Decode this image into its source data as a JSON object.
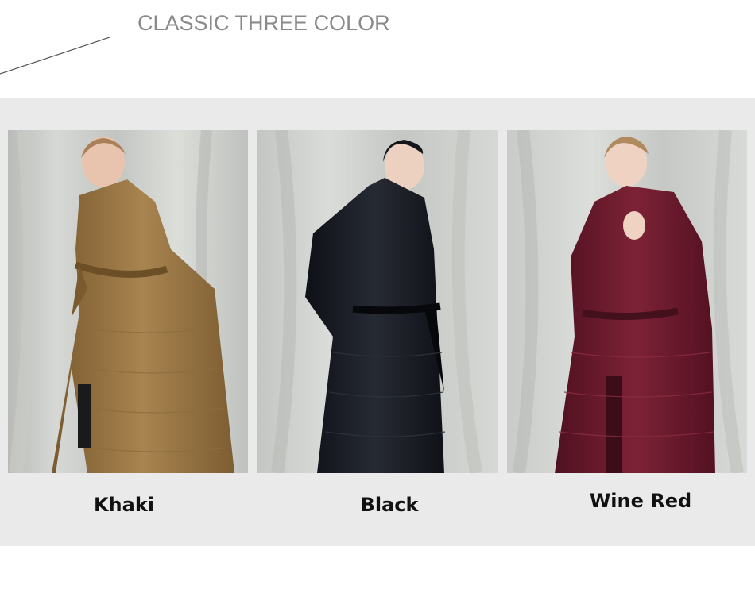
{
  "header": {
    "title": "CLASSIC THREE COLOR"
  },
  "colors": {
    "panel_background": "#eaeaea",
    "title_color": "#8a8a8a",
    "khaki": "#9a7642",
    "black": "#15171d",
    "wine_red": "#6e1a2c"
  },
  "products": [
    {
      "label": "Khaki",
      "image": "model-in-khaki-long-down-coat"
    },
    {
      "label": "Black",
      "image": "model-in-black-long-down-coat"
    },
    {
      "label": "Wine Red",
      "image": "model-in-wine-red-long-down-coat"
    }
  ]
}
